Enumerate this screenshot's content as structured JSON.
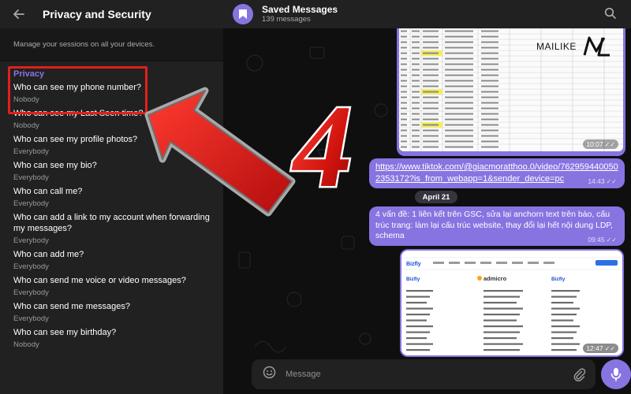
{
  "left_panel": {
    "title": "Privacy and Security",
    "sessions_note": "Manage your sessions on all your devices.",
    "section_heading": "Privacy",
    "items": [
      {
        "label": "Who can see my phone number?",
        "value": "Nobody"
      },
      {
        "label": "Who can see my Last Seen time?",
        "value": "Nobody"
      },
      {
        "label": "Who can see my profile photos?",
        "value": "Everybody"
      },
      {
        "label": "Who can see my bio?",
        "value": "Everybody"
      },
      {
        "label": "Who can call me?",
        "value": "Everybody"
      },
      {
        "label": "Who can add a link to my account when forwarding my messages?",
        "value": "Everybody"
      },
      {
        "label": "Who can add me?",
        "value": "Everybody"
      },
      {
        "label": "Who can send me voice or video messages?",
        "value": "Everybody"
      },
      {
        "label": "Who can send me messages?",
        "value": "Everybody"
      },
      {
        "label": "Who can see my birthday?",
        "value": "Nobody"
      }
    ]
  },
  "chat": {
    "title": "Saved Messages",
    "subtitle": "139 messages",
    "messages": {
      "image_sheet_time": "10:07",
      "link": "https://www.tiktok.com/@giacmoratthoo.0/video/7629594400502353172?is_from_webapp=1&sender_device=pc",
      "link_time": "14:43",
      "date_divider": "April 21",
      "text": "4 vấn đề: 1 liên kết trên GSC, sửa lại anchorn text trên báo, cấu trúc trang: làm lại cấu trúc website, thay đổi lại hết nội dung LDP, schema",
      "text_time": "09:45",
      "web_shot_time": "12:47",
      "web_shot_brands": [
        "Bizfly",
        "admicro",
        "Bizfly"
      ]
    },
    "composer_placeholder": "Message"
  },
  "watermark": {
    "brand": "MAILIKE",
    "monogram": "ML"
  },
  "annotation": {
    "step_number": "4"
  },
  "colors": {
    "accent": "#8774e1",
    "highlight": "#e0201c",
    "panel_bg": "#212121",
    "chat_bg": "#0f0f10"
  },
  "icons": {
    "back": "arrow-left-icon",
    "saved": "bookmark-icon",
    "search": "search-icon",
    "emoji": "smile-icon",
    "attach": "paperclip-icon",
    "mic": "microphone-icon"
  }
}
